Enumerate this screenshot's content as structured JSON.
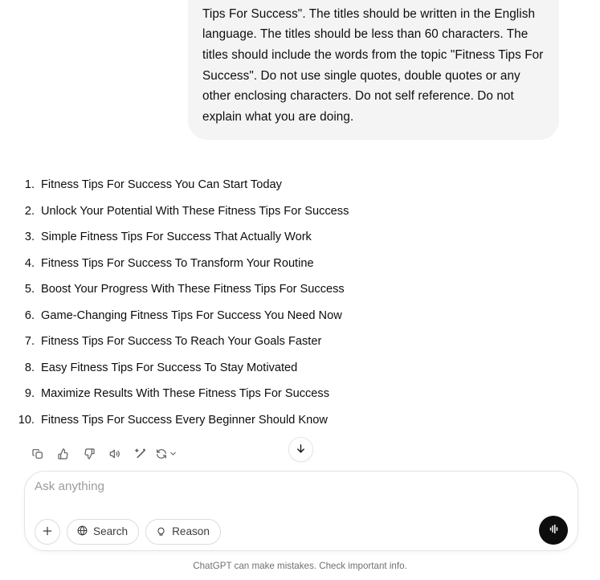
{
  "conversation": {
    "user_prompt": "who writes catchy titles for blog posts. You have a Friendly tone of voice. You have a Conversational writing style. Write 10 catchy blog post titles with a hook for the topic \"Fitness Tips For Success\". The titles should be written in the English language. The titles should be less than 60 characters. The titles should include the words from the topic \"Fitness Tips For Success\". Do not use single quotes, double quotes or any other enclosing characters. Do not self reference. Do not explain what you are doing.",
    "assistant_list": [
      {
        "number": "1.",
        "text": "Fitness Tips For Success You Can Start Today"
      },
      {
        "number": "2.",
        "text": "Unlock Your Potential With These Fitness Tips For Success"
      },
      {
        "number": "3.",
        "text": "Simple Fitness Tips For Success That Actually Work"
      },
      {
        "number": "4.",
        "text": "Fitness Tips For Success To Transform Your Routine"
      },
      {
        "number": "5.",
        "text": "Boost Your Progress With These Fitness Tips For Success"
      },
      {
        "number": "6.",
        "text": "Game-Changing Fitness Tips For Success You Need Now"
      },
      {
        "number": "7.",
        "text": "Fitness Tips For Success To Reach Your Goals Faster"
      },
      {
        "number": "8.",
        "text": "Easy Fitness Tips For Success To Stay Motivated"
      },
      {
        "number": "9.",
        "text": "Maximize Results With These Fitness Tips For Success"
      },
      {
        "number": "10.",
        "text": "Fitness Tips For Success Every Beginner Should Know"
      }
    ]
  },
  "message_actions": [
    {
      "name": "copy-icon",
      "tooltip": "Copy"
    },
    {
      "name": "thumbs-up-icon",
      "tooltip": "Good response"
    },
    {
      "name": "thumbs-down-icon",
      "tooltip": "Bad response"
    },
    {
      "name": "read-aloud-icon",
      "tooltip": "Read aloud"
    },
    {
      "name": "edit-in-canvas-icon",
      "tooltip": "Edit in canvas"
    },
    {
      "name": "regenerate-icon",
      "tooltip": "Switch model"
    }
  ],
  "scroll_button": {
    "name": "scroll-to-bottom",
    "glyph": "down-arrow"
  },
  "composer": {
    "placeholder": "Ask anything",
    "value": "",
    "add_label": "+",
    "search_label": "Search",
    "reason_label": "Reason",
    "voice_label": "voice-mode"
  },
  "footer": {
    "note": "ChatGPT can make mistakes. Check important info."
  },
  "colors": {
    "bubble_bg": "#f4f4f4",
    "page_bg": "#ffffff",
    "text": "#0d0d0d",
    "muted": "#707070",
    "voice_btn_bg": "#0d0d0d"
  }
}
